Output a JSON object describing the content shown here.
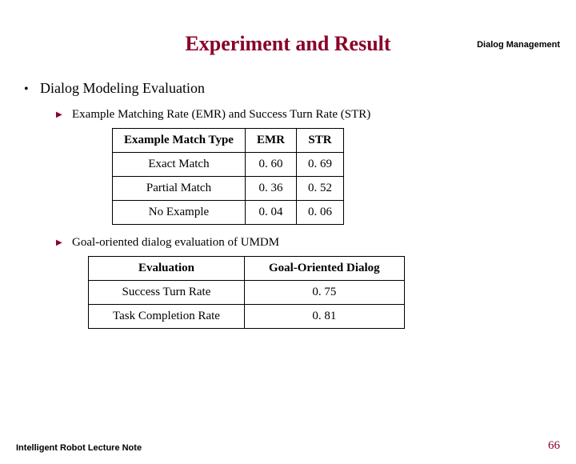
{
  "header": "Dialog Management",
  "title": "Experiment and Result",
  "bullet": "Dialog Modeling Evaluation",
  "sub1": "Example Matching Rate (EMR) and Success Turn Rate (STR)",
  "sub2": "Goal-oriented dialog evaluation of UMDM",
  "table1": {
    "h1": "Example Match Type",
    "h2": "EMR",
    "h3": "STR",
    "r1c1": "Exact Match",
    "r1c2": "0. 60",
    "r1c3": "0. 69",
    "r2c1": "Partial Match",
    "r2c2": "0. 36",
    "r2c3": "0. 52",
    "r3c1": "No Example",
    "r3c2": "0. 04",
    "r3c3": "0. 06"
  },
  "table2": {
    "h1": "Evaluation",
    "h2": "Goal-Oriented Dialog",
    "r1c1": "Success Turn Rate",
    "r1c2": "0. 75",
    "r2c1": "Task Completion Rate",
    "r2c2": "0. 81"
  },
  "footer_left": "Intelligent Robot Lecture Note",
  "footer_right": "66",
  "chart_data": [
    {
      "type": "table",
      "title": "Example Matching Rate (EMR) and Success Turn Rate (STR)",
      "columns": [
        "Example Match Type",
        "EMR",
        "STR"
      ],
      "rows": [
        [
          "Exact Match",
          0.6,
          0.69
        ],
        [
          "Partial Match",
          0.36,
          0.52
        ],
        [
          "No Example",
          0.04,
          0.06
        ]
      ]
    },
    {
      "type": "table",
      "title": "Goal-oriented dialog evaluation of UMDM",
      "columns": [
        "Evaluation",
        "Goal-Oriented Dialog"
      ],
      "rows": [
        [
          "Success Turn Rate",
          0.75
        ],
        [
          "Task Completion Rate",
          0.81
        ]
      ]
    }
  ]
}
